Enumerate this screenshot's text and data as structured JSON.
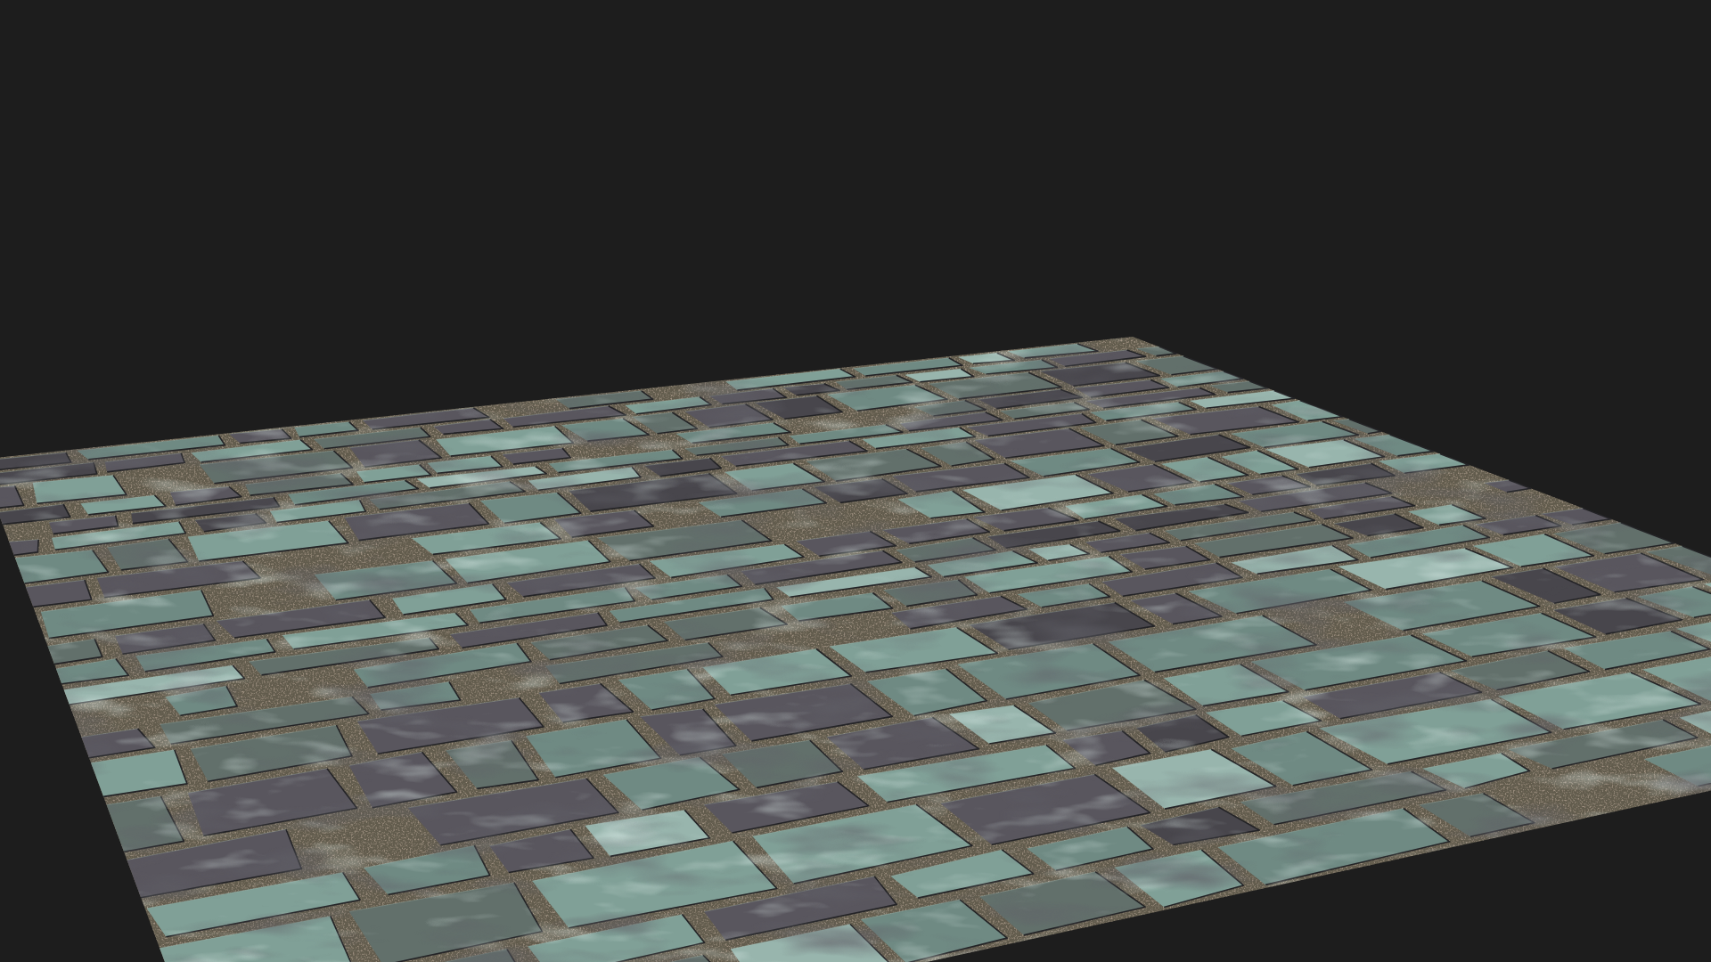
{
  "viewport": {
    "objects": [
      {
        "kind": "plane"
      }
    ]
  }
}
